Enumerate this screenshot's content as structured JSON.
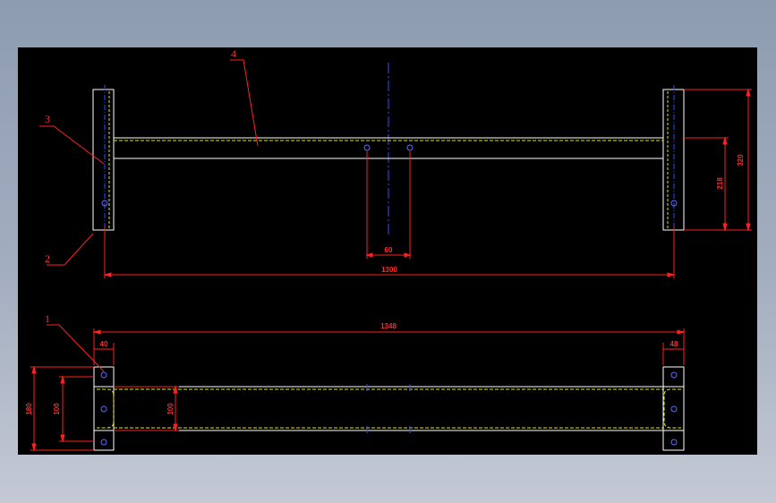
{
  "drawing": {
    "colors": {
      "background": "#000000",
      "outline": "#ffffff",
      "hidden": "#e8e800",
      "dimension": "#ff2020",
      "center": "#2f4cff",
      "hole": "#5a6dff"
    },
    "part_labels": {
      "p1": "1",
      "p2": "2",
      "p3": "3",
      "p4": "4"
    },
    "dimensions": {
      "front_hole_spacing": "60",
      "front_overall": "1300",
      "front_height_right_inner": "218",
      "front_height_right_outer": "320",
      "plan_overall": "1348",
      "plan_end_left": "40",
      "plan_end_right": "48",
      "plan_depth_outer": "180",
      "plan_depth_inner": "100",
      "plan_beam_width": "100"
    }
  }
}
